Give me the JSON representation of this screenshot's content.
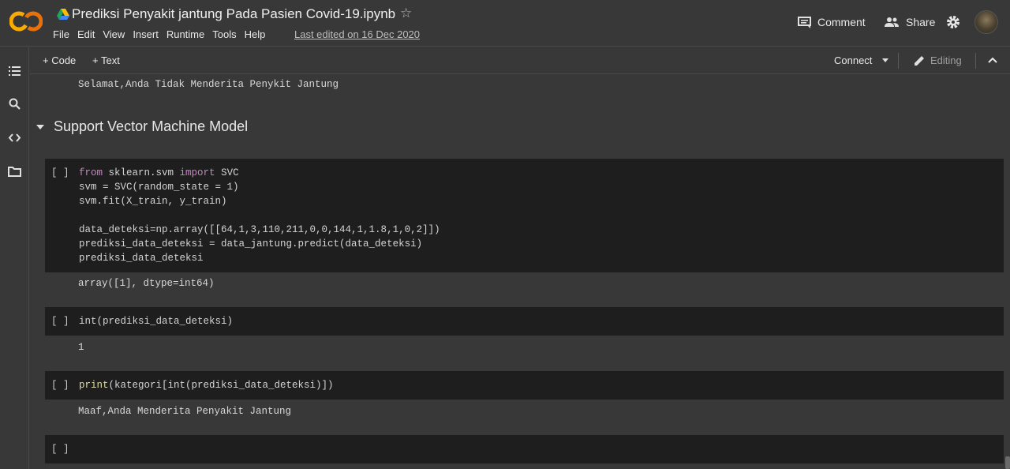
{
  "header": {
    "logo_text": "CO",
    "title": "Prediksi Penyakit jantung Pada Pasien Covid-19.ipynb",
    "star_icon": "star-icon",
    "menu": [
      "File",
      "Edit",
      "View",
      "Insert",
      "Runtime",
      "Tools",
      "Help"
    ],
    "last_edited": "Last edited on 16 Dec 2020",
    "comment_label": "Comment",
    "share_label": "Share"
  },
  "toolbar": {
    "add_code": "+ Code",
    "add_text": "+ Text",
    "connect": "Connect",
    "editing": "Editing"
  },
  "notebook": {
    "prev_output": "Selamat,Anda Tidak Menderita Penykit Jantung",
    "section_title": "Support Vector Machine Model",
    "cells": [
      {
        "bracket": "[ ]",
        "code_lines": [
          "from sklearn.svm import SVC",
          "svm = SVC(random_state = 1)",
          "svm.fit(X_train, y_train)",
          "",
          "data_deteksi=np.array([[64,1,3,110,211,0,0,144,1,1.8,1,0,2]])",
          "prediksi_data_deteksi = data_jantung.predict(data_deteksi)",
          "prediksi_data_deteksi"
        ],
        "output": "array([1], dtype=int64)"
      },
      {
        "bracket": "[ ]",
        "code_lines": [
          "int(prediksi_data_deteksi)"
        ],
        "output": "1"
      },
      {
        "bracket": "[ ]",
        "code_lines": [
          "print(kategori[int(prediksi_data_deteksi)])"
        ],
        "output": "Maaf,Anda Menderita Penyakit Jantung"
      },
      {
        "bracket": "[ ]",
        "code_lines": [],
        "output": ""
      }
    ]
  },
  "colors": {
    "background": "#383838",
    "cell_bg": "#1e1e1e",
    "logo_orange": "#f9ab00",
    "keyword": "#c586c0",
    "number": "#b5cea8"
  }
}
